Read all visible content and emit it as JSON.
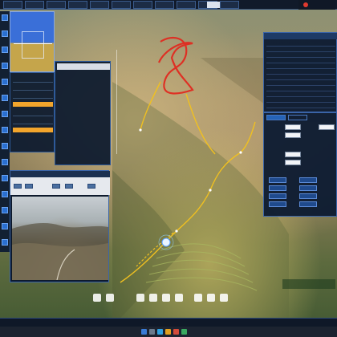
{
  "app": {
    "menu": [
      "",
      "",
      "",
      "",
      "",
      "",
      "",
      "",
      "",
      "",
      ""
    ],
    "window_button": "",
    "brand": "",
    "licensed_notice": ""
  },
  "hud": {
    "heading": ""
  },
  "telemetry": {
    "values": [
      "",
      "",
      "",
      "",
      "",
      ""
    ],
    "highlight": [
      "",
      ""
    ]
  },
  "params": {
    "title": "",
    "lines": [
      "",
      "",
      "",
      "",
      "",
      "",
      "",
      "",
      "",
      "",
      "",
      "",
      "",
      "",
      "",
      "",
      ""
    ]
  },
  "video": {
    "title": "",
    "status": ""
  },
  "right_panel": {
    "title": "",
    "columns": [
      "",
      "",
      "",
      ""
    ],
    "rows": [
      [
        "",
        "",
        "",
        ""
      ],
      [
        "",
        "",
        "",
        ""
      ],
      [
        "",
        "",
        "",
        ""
      ],
      [
        "",
        "",
        "",
        ""
      ],
      [
        "",
        "",
        "",
        ""
      ],
      [
        "",
        "",
        "",
        ""
      ],
      [
        "",
        "",
        "",
        ""
      ],
      [
        "",
        "",
        "",
        ""
      ],
      [
        "",
        "",
        "",
        ""
      ],
      [
        "",
        "",
        "",
        ""
      ],
      [
        "",
        "",
        "",
        ""
      ],
      [
        "",
        "",
        "",
        ""
      ]
    ]
  },
  "settings": {
    "tabs": [
      "",
      ""
    ],
    "labels": [
      "",
      "",
      "",
      "",
      ""
    ],
    "fields": [
      "",
      "",
      "",
      "",
      ""
    ],
    "buttons": [
      "",
      "",
      "",
      "",
      "",
      "",
      "",
      ""
    ]
  },
  "overlay": {
    "watermark": ""
  },
  "status": {
    "items": [
      "",
      "",
      "",
      "",
      "",
      "",
      "",
      "",
      "",
      ""
    ]
  },
  "taskbar": {
    "clock": ""
  },
  "colors": {
    "track": "#f0c020",
    "history_track": "#e02a20",
    "panel": "#0c1a32",
    "accent": "#2a6fd0",
    "warn": "#f2a52c"
  }
}
